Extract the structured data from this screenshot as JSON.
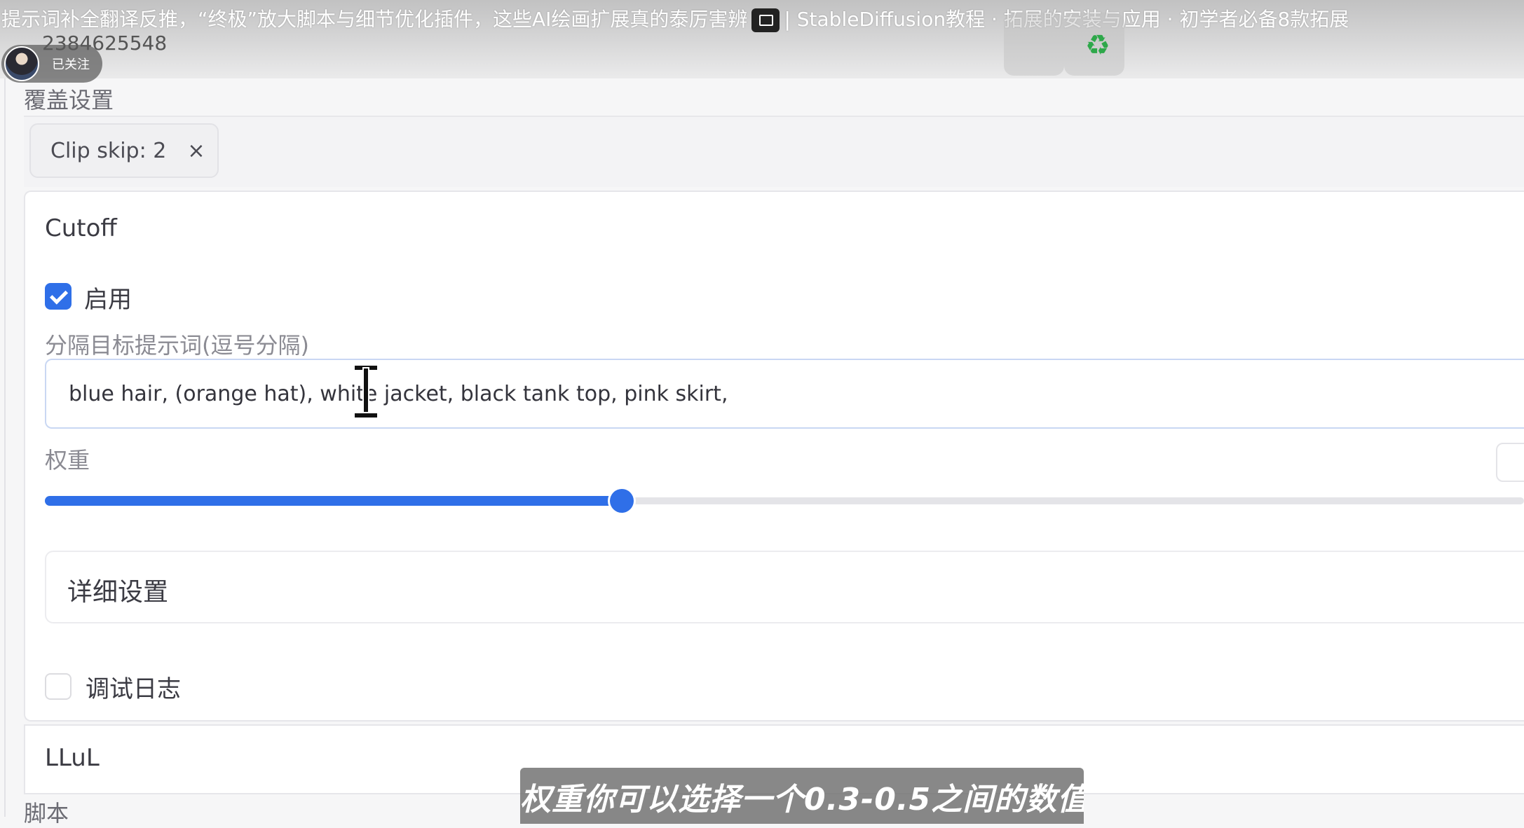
{
  "video": {
    "title_left": "提示词补全翻译反推，“终极”放大脚本与细节优化插件，这些AI绘画扩展真的泰厉害辨",
    "title_right": "| StableDiffusion教程 · 拓展的安装与应用 · 初学者必备8款拓展",
    "uploader_id": "2384625548",
    "follow_status": "已关注",
    "subtitle": "权重你可以选择一个0.3-0.5之间的数值"
  },
  "override_settings": {
    "title": "覆盖设置",
    "chip_label": "Clip skip: 2",
    "chip_close": "×"
  },
  "cutoff": {
    "title": "Cutoff",
    "enable": {
      "label": "启用",
      "checked": true
    },
    "target_label": "分隔目标提示词(逗号分隔)",
    "target_value": "blue hair, (orange hat), white jacket, black tank top, pink skirt,",
    "weight_label": "权重",
    "weight_fraction": 0.39,
    "detail_settings_label": "详细设置",
    "debug_log": {
      "label": "调试日志",
      "checked": false
    }
  },
  "llul": {
    "title": "LLuL"
  },
  "script": {
    "label": "脚本"
  },
  "colors": {
    "accent": "#2f6fe8",
    "recycle_green": "#2ea84a"
  },
  "icons": {
    "pip": "picture-in-picture-icon",
    "recycle": "recycle-icon",
    "close": "close-icon",
    "text_cursor": "i-beam-cursor-icon"
  }
}
